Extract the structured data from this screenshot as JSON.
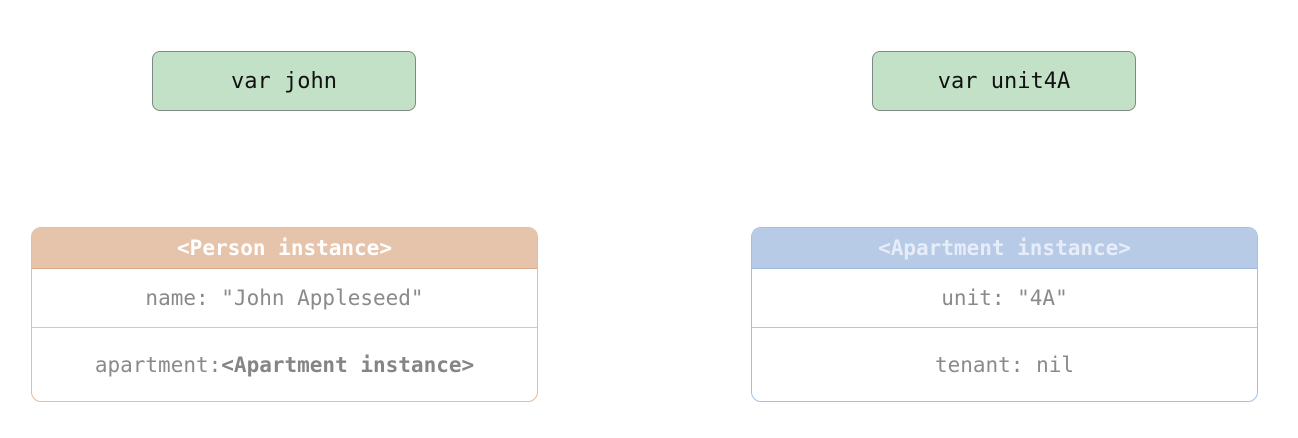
{
  "variables": {
    "john": "var john",
    "unit4A": "var unit4A"
  },
  "person_instance": {
    "header": "<Person instance>",
    "name_row": "name: \"John Appleseed\"",
    "apartment_label": "apartment: ",
    "apartment_value": "<Apartment instance>"
  },
  "apartment_instance": {
    "header": "<Apartment instance>",
    "unit_row": "unit: \"4A\"",
    "tenant_row": "tenant: nil"
  },
  "colors": {
    "variable_fill": "#c3e1c7",
    "person_header": "#e6c4ab",
    "apartment_header": "#b7cae6"
  }
}
